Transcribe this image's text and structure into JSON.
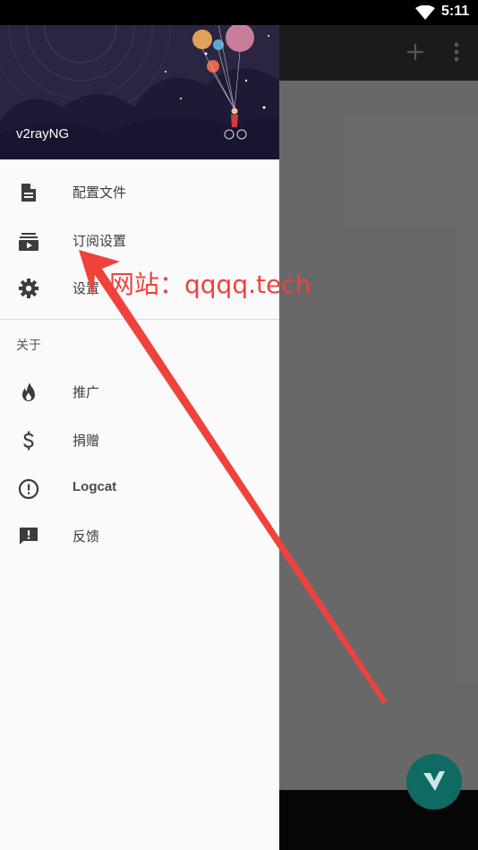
{
  "status_bar": {
    "time": "5:11"
  },
  "drawer": {
    "header": {
      "app_name": "v2rayNG"
    },
    "items": [
      {
        "label": "配置文件",
        "icon": "document-icon"
      },
      {
        "label": "订阅设置",
        "icon": "subscriptions-icon"
      },
      {
        "label": "设置",
        "icon": "gear-icon"
      }
    ],
    "section_label": "关于",
    "about_items": [
      {
        "label": "推广",
        "icon": "fire-icon"
      },
      {
        "label": "捐赠",
        "icon": "dollar-icon"
      },
      {
        "label": "Logcat",
        "icon": "alert-circle-icon"
      },
      {
        "label": "反馈",
        "icon": "feedback-icon"
      }
    ]
  },
  "annotation": {
    "watermark_text": "网站：qqqq.tech",
    "arrow_color": "#f0423c"
  },
  "colors": {
    "fab": "#0e6a62",
    "toolbar": "#2c2c2c",
    "drawer_bg": "#fafafa",
    "icon": "#3c3c3c"
  }
}
